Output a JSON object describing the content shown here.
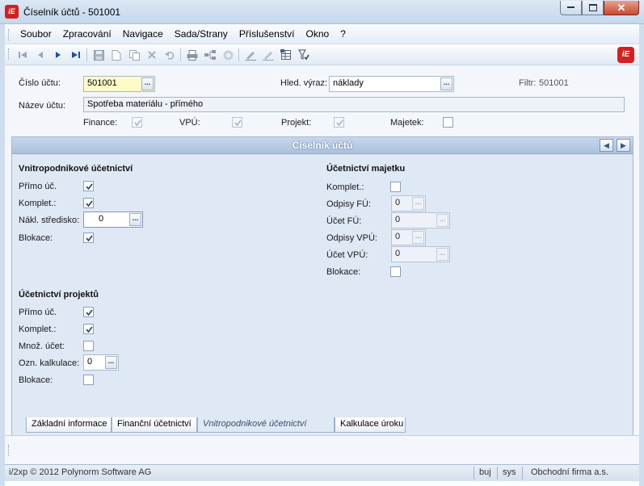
{
  "window": {
    "title": "Číselník účtů - 501001",
    "logo_text": "iE",
    "close_glyph": "✕"
  },
  "menu": [
    "Soubor",
    "Zpracování",
    "Navigace",
    "Sada/Strany",
    "Příslušenství",
    "Okno",
    "?"
  ],
  "toolbar_icons": [
    "first-record-icon",
    "prev-record-icon",
    "next-record-icon",
    "last-record-icon",
    "save-icon",
    "new-icon",
    "copy-icon",
    "delete-icon",
    "undo-icon",
    "print-icon",
    "tree-icon",
    "refresh-icon",
    "edit-icon",
    "edit-alt-icon",
    "table-icon",
    "filter-icon"
  ],
  "header": {
    "account_label": "Číslo účtu:",
    "account_value": "501001",
    "search_label": "Hled. výraz:",
    "search_value": "náklady",
    "filter_label": "Filtr:",
    "filter_value": "501001",
    "name_label": "Název účtu:",
    "name_value": "Spotřeba materiálu - přímého",
    "checks": [
      {
        "label": "Finance:",
        "checked": true,
        "enabled": false
      },
      {
        "label": "VPÚ:",
        "checked": true,
        "enabled": false
      },
      {
        "label": "Projekt:",
        "checked": true,
        "enabled": false
      },
      {
        "label": "Majetek:",
        "checked": false,
        "enabled": true
      }
    ],
    "dots": "..."
  },
  "panel": {
    "title": "Číselník účtů",
    "internal": {
      "title": "Vnitropodnikové účetnictví",
      "primo_label": "Přímo úč.",
      "primo": true,
      "komplet_label": "Komplet.:",
      "komplet": true,
      "stredisko_label": "Nákl. středisko:",
      "stredisko_value": "0",
      "blokace_label": "Blokace:",
      "blokace": true
    },
    "projects": {
      "title": "Účetnictví projektů",
      "primo_label": "Přímo úč.",
      "primo": true,
      "komplet_label": "Komplet.:",
      "komplet": true,
      "mnoz_label": "Množ. účet:",
      "mnoz": false,
      "kalkulace_label": "Ozn. kalkulace:",
      "kalkulace_value": "0",
      "blokace_label": "Blokace:",
      "blokace": false
    },
    "assets": {
      "title": "Účetnictví majetku",
      "komplet_label": "Komplet.:",
      "komplet": false,
      "odpisy_fu_label": "Odpisy FÚ:",
      "odpisy_fu": "0",
      "ucet_fu_label": "Účet FÚ:",
      "ucet_fu": "0",
      "odpisy_vpu_label": "Odpisy VPÚ:",
      "odpisy_vpu": "0",
      "ucet_vpu_label": "Účet VPÚ:",
      "ucet_vpu": "0",
      "blokace_label": "Blokace:",
      "blokace": false
    }
  },
  "tabs": [
    "Základní informace",
    "Finanční účetnictví",
    "Vnitropodnikové účetnictví",
    "Kalkulace úroku"
  ],
  "status": {
    "copyright": "i/2xp © 2012 Polynorm Software AG",
    "user": "buj",
    "db": "sys",
    "company": "Obchodní firma a.s."
  },
  "colors": {
    "brand": "#d42020",
    "panel_head": "#a9c0dc",
    "panel_bg": "#dfe8f5"
  }
}
